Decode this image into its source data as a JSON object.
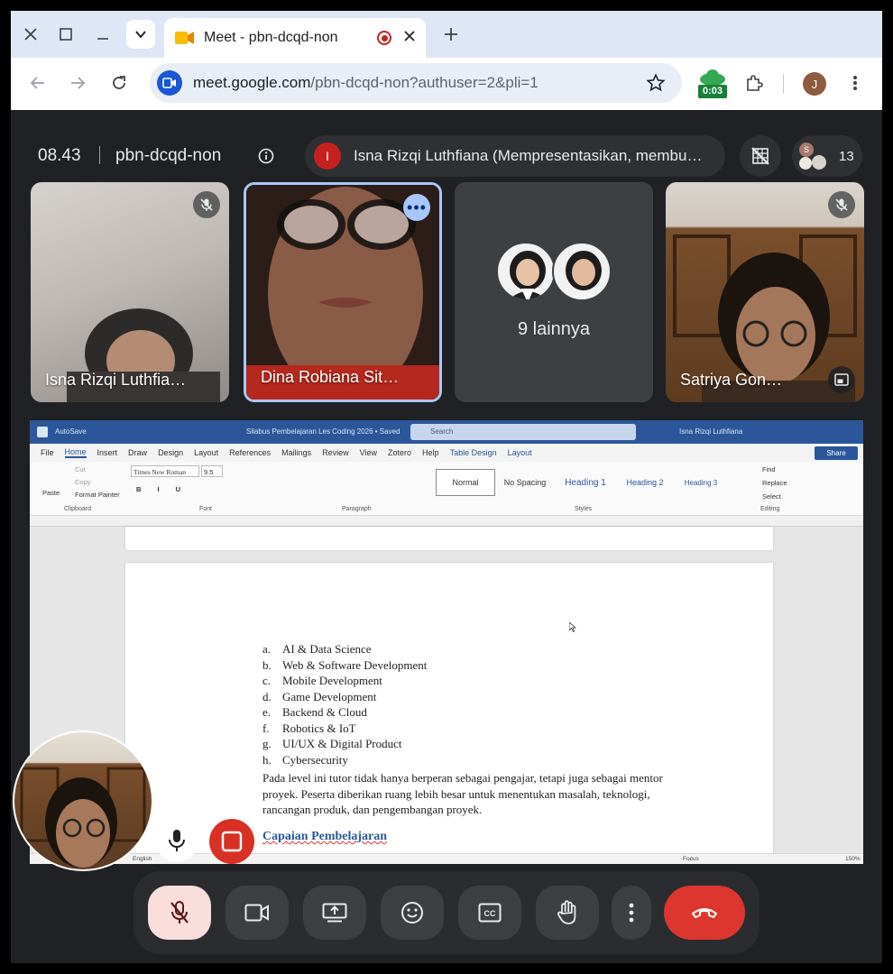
{
  "browser": {
    "tab_title": "Meet - pbn-dcqd-non",
    "url_host": "meet.google.com",
    "url_path": "/pbn-dcqd-non?authuser=2&pli=1",
    "timer_badge": "0:03",
    "profile_initial": "J"
  },
  "meet": {
    "time": "08.43",
    "meeting_code": "pbn-dcqd-non",
    "presenter_initial": "I",
    "presenting_text": "Isna Rizqi Luthfiana (Mempresentasikan, membu…",
    "participant_avatar_initial": "S",
    "participant_count": "13"
  },
  "tiles": [
    {
      "name": "Isna Rizqi Luthfia…"
    },
    {
      "name": "Dina Robiana Sit…"
    },
    {
      "name": "9 lainnya"
    },
    {
      "name": "Satriya Gon…"
    }
  ],
  "word": {
    "autosave": "AutoSave",
    "doc_title": "Silabus Pembelajaran Les Coding 2026 • Saved",
    "search_placeholder": "Search",
    "user": "Isna Rizqi Luthfiana",
    "menu": [
      "File",
      "Home",
      "Insert",
      "Draw",
      "Design",
      "Layout",
      "References",
      "Mailings",
      "Review",
      "View",
      "Zotero",
      "Help",
      "Table Design",
      "Layout"
    ],
    "share": "Share",
    "ribbon": {
      "paste": "Paste",
      "cut": "Cut",
      "copy": "Copy",
      "format_painter": "Format Painter",
      "font_name": "Times New Roman",
      "font_size": "9.5",
      "styles": [
        "Normal",
        "No Spacing",
        "Heading 1",
        "Heading 2",
        "Heading 3"
      ],
      "find": "Find",
      "replace": "Replace",
      "select": "Select",
      "group_labels": [
        "Clipboard",
        "Font",
        "Paragraph",
        "Styles",
        "Editing"
      ]
    },
    "document": {
      "list": [
        {
          "marker": "a.",
          "text": "AI & Data Science"
        },
        {
          "marker": "b.",
          "text": "Web & Software Development"
        },
        {
          "marker": "c.",
          "text": "Mobile Development"
        },
        {
          "marker": "d.",
          "text": "Game Development"
        },
        {
          "marker": "e.",
          "text": "Backend & Cloud"
        },
        {
          "marker": "f.",
          "text": "Robotics & IoT"
        },
        {
          "marker": "g.",
          "text": "UI/UX & Digital Product"
        },
        {
          "marker": "h.",
          "text": "Cybersecurity"
        }
      ],
      "paragraph": "Pada level ini tutor tidak hanya berperan sebagai pengajar, tetapi juga sebagai mentor proyek. Peserta diberikan ruang lebih besar untuk menentukan masalah, teknologi, rancangan produk, dan pengembangan proyek.",
      "heading": "Capaian Pembelajaran"
    },
    "status": {
      "language": "English",
      "focus": "Focus",
      "zoom": "150%"
    }
  },
  "colors": {
    "meet_bg": "#202124",
    "leave_red": "#dc362e",
    "mic_off_bg": "#f9dedc",
    "word_blue": "#2b579a",
    "speaking_outline": "#a8c7fa"
  }
}
